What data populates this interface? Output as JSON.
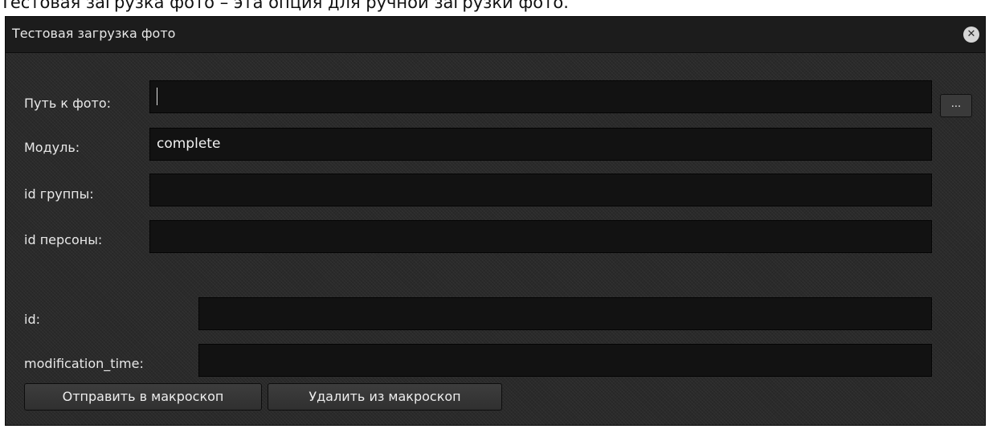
{
  "caption": "Тестовая загрузка фото – эта опция для ручной загрузки фото.",
  "dialog": {
    "title": "Тестовая загрузка фото",
    "close_icon": "close-icon"
  },
  "form": {
    "photo_path": {
      "label": "Путь к фото:",
      "value": ""
    },
    "browse_label": "...",
    "module": {
      "label": "Модуль:",
      "value": "complete"
    },
    "group_id": {
      "label": "id группы:",
      "value": ""
    },
    "person_id": {
      "label": "id персоны:",
      "value": ""
    },
    "id": {
      "label": "id:",
      "value": ""
    },
    "modification_time": {
      "label": "modification_time:",
      "value": ""
    }
  },
  "buttons": {
    "send": "Отправить в макроскоп",
    "delete": "Удалить из макроскоп"
  }
}
